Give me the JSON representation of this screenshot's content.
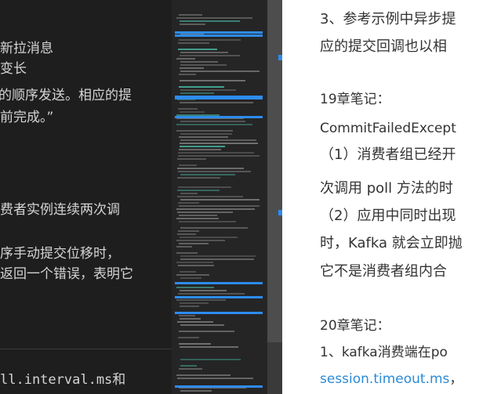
{
  "left_editor": {
    "lines": [
      "新拉消息",
      "变长",
      "的顺序发送。相应的提",
      "前完成。”",
      "费者实例连续两次调",
      "序手动提交位移时，",
      "返回一个错误，表明它"
    ],
    "code_line": "ll.interval.ms和"
  },
  "right_notes": {
    "para1_line1": "3、参考示例中异步提",
    "para1_line2": "应的提交回调也以相",
    "ch19_heading": "19章笔记：",
    "ch19_line1": "CommitFailedExcept",
    "ch19_line2": "（1）消费者组已经开",
    "ch19_line3": "次调用 poll 方法的时",
    "ch19_line4": "（2）应用中同时出现",
    "ch19_line5": "时，Kafka 就会立即抛",
    "ch19_line6": "它不是消费者组内合",
    "ch20_heading": "20章笔记：",
    "ch20_line1": "1、kafka消费端在po",
    "ch20_link": "session.timeout.ms",
    "ch20_link_suffix": "，"
  },
  "colors": {
    "editor_bg": "#1e1e1e",
    "editor_text": "#d4d4d4",
    "minimap_bg": "#252526",
    "scroll_thumb": "#4d4d4d",
    "accent_blue": "#2d8cf0",
    "link_blue": "#2b8bd6",
    "note_text": "#333333"
  }
}
